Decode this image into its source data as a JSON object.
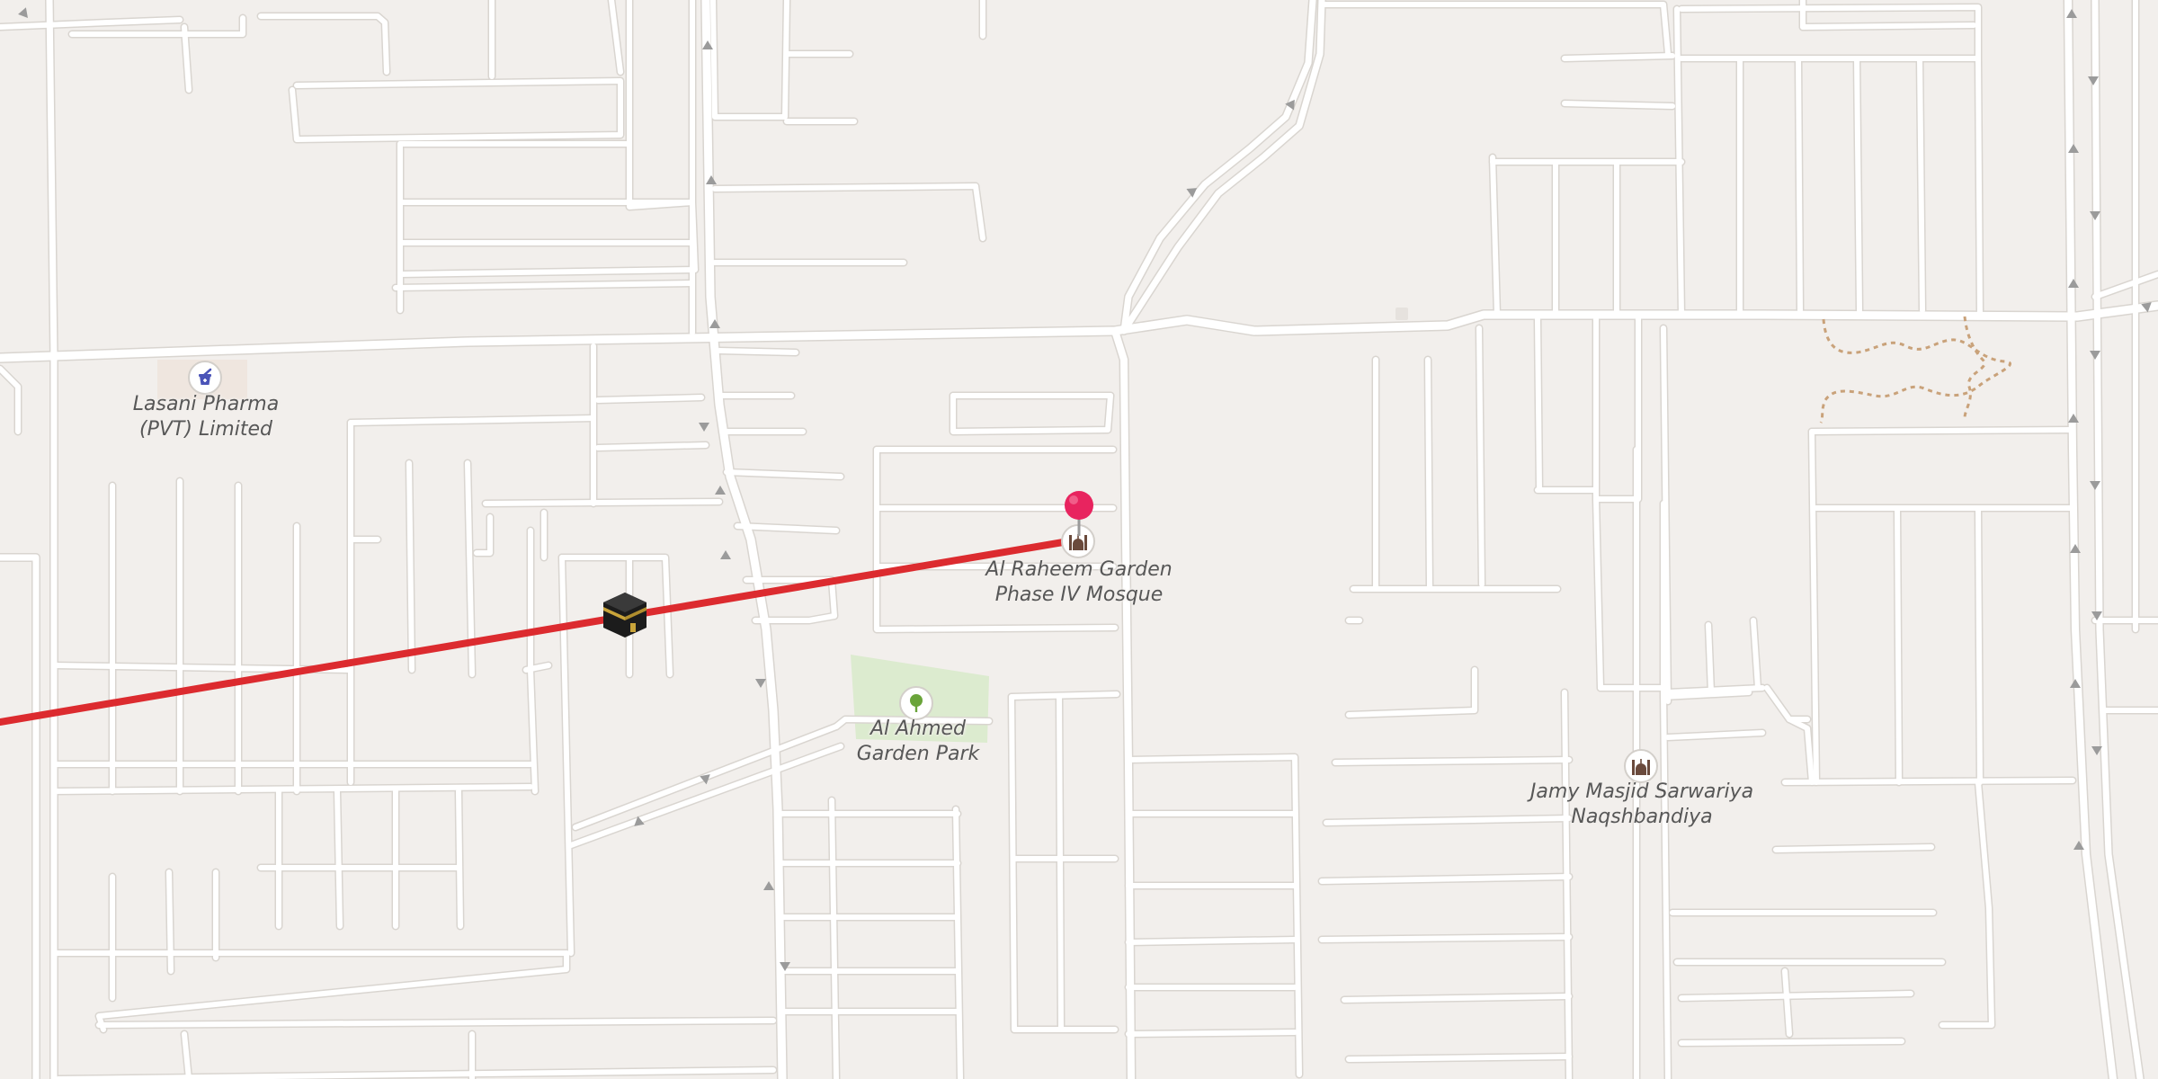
{
  "map": {
    "colors": {
      "background": "#f2efec",
      "road": "#ffffff",
      "road_casing": "#d9d5d0",
      "park": "#dcebcf",
      "route_line": "#dc2b2f",
      "pin": "#e8245f",
      "footpath": "#c9a27a"
    },
    "route": {
      "type": "qibla-direction-line",
      "icon": "kaaba-icon"
    },
    "pin": {
      "icon": "map-pin-icon"
    },
    "pois": [
      {
        "id": "lasani",
        "icon": "pharmacy-icon",
        "line1": "Lasani Pharma",
        "line2": "(PVT) Limited"
      },
      {
        "id": "alraheem",
        "icon": "mosque-icon",
        "line1": "Al Raheem Garden",
        "line2": "Phase IV Mosque"
      },
      {
        "id": "alahmed",
        "icon": "park-tree-icon",
        "line1": "Al Ahmed",
        "line2": "Garden Park"
      },
      {
        "id": "jamy",
        "icon": "mosque-icon",
        "line1": "Jamy Masjid Sarwariya",
        "line2": "Naqshbandiya"
      }
    ]
  }
}
